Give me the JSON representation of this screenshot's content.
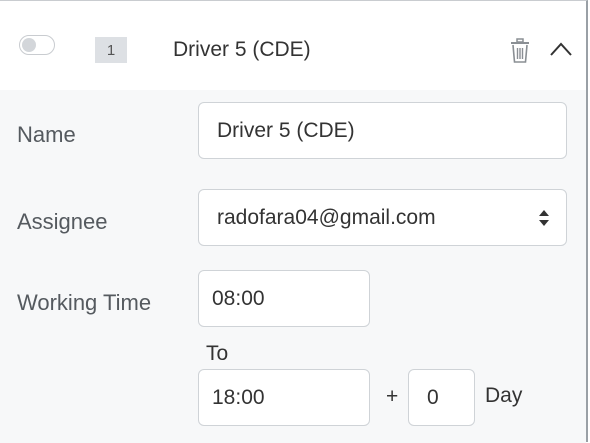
{
  "header": {
    "toggle_enabled": false,
    "index": "1",
    "title": "Driver 5 (CDE)",
    "delete_icon": "trash-icon",
    "collapse_icon": "chevron-up-icon"
  },
  "form": {
    "name_label": "Name",
    "name_value": "Driver 5 (CDE)",
    "assignee_label": "Assignee",
    "assignee_value": "radofara04@gmail.com",
    "working_time_label": "Working Time",
    "start_time": "08:00",
    "to_label": "To",
    "end_time": "18:00",
    "plus_label": "+",
    "day_offset": "0",
    "day_label": "Day"
  }
}
